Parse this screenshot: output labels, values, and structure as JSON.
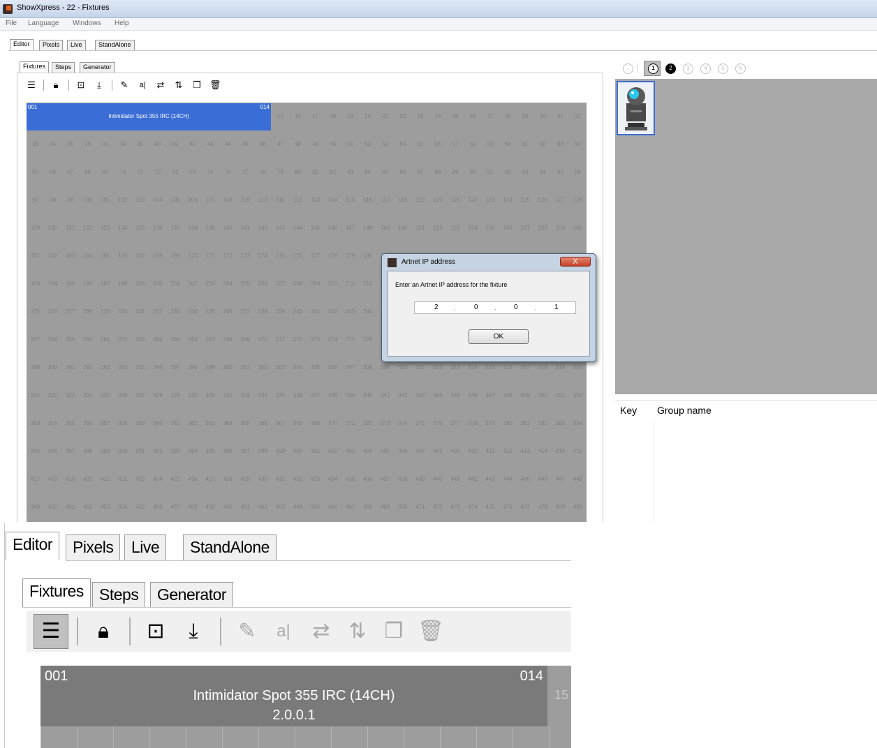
{
  "window": {
    "title": "ShowXpress - 22 - Fixtures"
  },
  "menu": [
    "File",
    "Language",
    "Windows",
    "Help"
  ],
  "main_tabs": [
    "Editor",
    "Pixels",
    "Live",
    "StandAlone"
  ],
  "sub_tabs": [
    "Fixtures",
    "Steps",
    "Generator"
  ],
  "toolbar_icons": [
    "list-icon",
    "lock-icon",
    "new-fixture-icon",
    "import-icon",
    "pencil-icon",
    "rename-icon",
    "swap-horizontal-icon",
    "swap-vertical-icon",
    "copy-icon",
    "trash-icon"
  ],
  "fixture": {
    "start": "001",
    "end": "014",
    "name": "Intimidator Spot 355 IRC (14CH)",
    "ip": "2.0.0.1",
    "next_channel": "15"
  },
  "grid": {
    "columns": 32,
    "rows": 15,
    "channels_per_row": 32
  },
  "dialog": {
    "title": "Artnet IP address",
    "prompt": "Enter an Artnet IP address for the fixture",
    "ip_octets": [
      "2",
      "0",
      "0",
      "1"
    ],
    "ok_label": "OK",
    "close_label": "X"
  },
  "pages": [
    "1",
    "2",
    "3",
    "4",
    "5",
    "6"
  ],
  "groups_table": {
    "headers": [
      "Key",
      "Group name"
    ]
  },
  "colors": {
    "selected": "#3a6dd6",
    "grid": "#9d9d9d",
    "fixture_zoom": "#7a7a7a"
  }
}
